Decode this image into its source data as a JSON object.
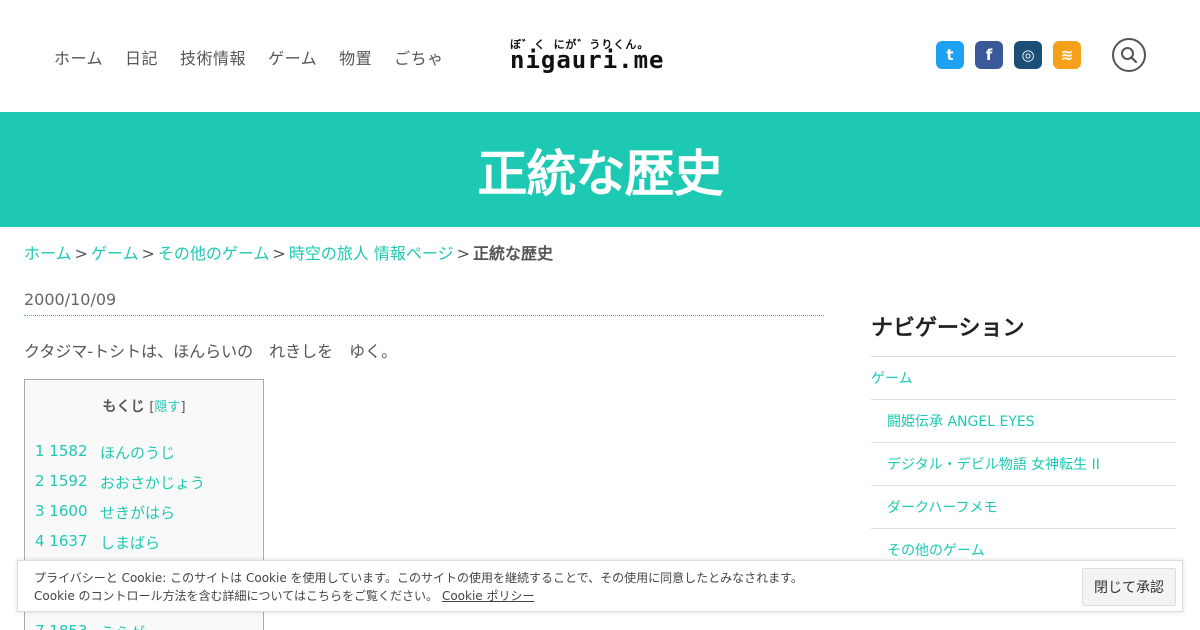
{
  "header": {
    "nav": [
      "ホーム",
      "日記",
      "技術情報",
      "ゲーム",
      "物置",
      "ごちゃ"
    ],
    "logo_top": "ぼ゛く にが゛うりくん。",
    "logo_main": "nigauri.me",
    "social": [
      {
        "name": "twitter-icon",
        "glyph": "t",
        "color": "#1da1f2"
      },
      {
        "name": "facebook-icon",
        "glyph": "f",
        "color": "#3b5998"
      },
      {
        "name": "instagram-icon",
        "glyph": "◎",
        "color": "#1d4e78"
      },
      {
        "name": "rss-icon",
        "glyph": "≋",
        "color": "#f6a01a"
      }
    ]
  },
  "page": {
    "title": "正統な歴史",
    "accent": "#1ec9b3"
  },
  "breadcrumb": {
    "items": [
      "ホーム",
      "ゲーム",
      "その他のゲーム",
      "時空の旅人 情報ページ"
    ],
    "separator": ">",
    "current": "正統な歴史"
  },
  "post": {
    "date": "2000/10/09",
    "intro": "クタジマ-トシトは、ほんらいの　れきしを　ゆく。"
  },
  "toc": {
    "title": "もくじ",
    "hide_open": "[",
    "hide_label": "隠す",
    "hide_close": "]",
    "items": [
      {
        "num": "1 1582",
        "label": "ほんのうじ"
      },
      {
        "num": "2 1592",
        "label": "おおさかじょう"
      },
      {
        "num": "3 1600",
        "label": "せきがはら"
      },
      {
        "num": "4 1637",
        "label": "しまばら"
      },
      {
        "num": "",
        "label": ""
      },
      {
        "num": "",
        "label": ""
      },
      {
        "num": "7 1853",
        "label": "うらが"
      }
    ]
  },
  "sidebar": {
    "title": "ナビゲーション",
    "items": [
      {
        "label": "ゲーム",
        "sub": false
      },
      {
        "label": "闘姫伝承 ANGEL EYES",
        "sub": true
      },
      {
        "label": "デジタル・デビル物語 女神転生 II",
        "sub": true
      },
      {
        "label": "ダークハーフメモ",
        "sub": true
      },
      {
        "label": "その他のゲーム",
        "sub": true
      }
    ]
  },
  "cookie": {
    "line1": "プライバシーと Cookie: このサイトは Cookie を使用しています。このサイトの使用を継続することで、その使用に同意したとみなされます。",
    "line2": "Cookie のコントロール方法を含む詳細についてはこちらをご覧ください。",
    "link": "Cookie ポリシー",
    "button": "閉じて承認"
  }
}
